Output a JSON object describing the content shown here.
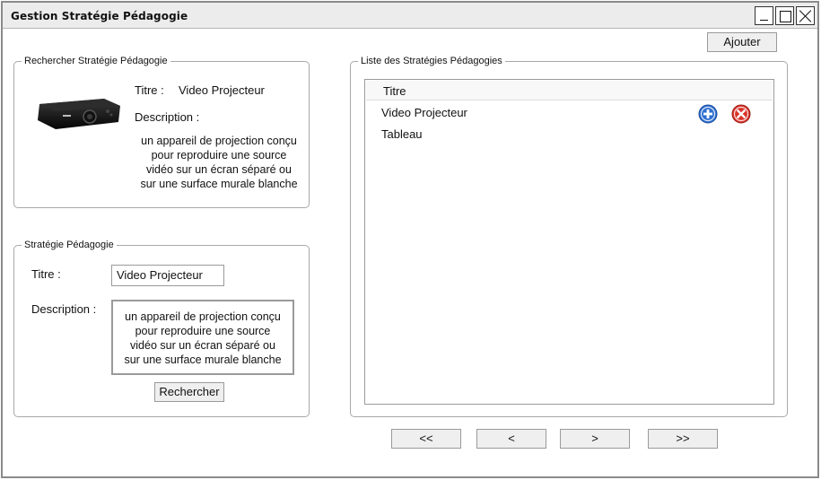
{
  "window": {
    "title": "Gestion Stratégie Pédagogie"
  },
  "toolbar": {
    "add_label": "Ajouter"
  },
  "search_panel": {
    "legend": "Rechercher Stratégie Pédagogie",
    "titre_label": "Titre :",
    "titre_value": "Video Projecteur",
    "description_label": "Description :",
    "description_lines": [
      "un appareil de projection conçu",
      "pour reproduire une source",
      "vidéo sur un écran séparé ou",
      "sur une surface murale blanche"
    ]
  },
  "form_panel": {
    "legend": "Stratégie Pédagogie",
    "titre_label": "Titre :",
    "titre_value": "Video Projecteur",
    "description_label": "Description :",
    "description_lines": [
      "un appareil de projection conçu",
      "pour reproduire une source",
      "vidéo sur un écran séparé ou",
      "sur une surface murale blanche"
    ],
    "search_button": "Rechercher"
  },
  "list_panel": {
    "legend": "Liste des Stratégies Pédagogies",
    "column_header": "Titre",
    "rows": [
      "Video Projecteur",
      "Tableau"
    ]
  },
  "pagination": {
    "first": "<<",
    "prev": "<",
    "next": ">",
    "last": ">>"
  },
  "icons": {
    "add": "plus-circle-icon",
    "delete": "delete-circle-icon",
    "add_color": "#2f6fd0",
    "delete_color": "#d9342b"
  }
}
